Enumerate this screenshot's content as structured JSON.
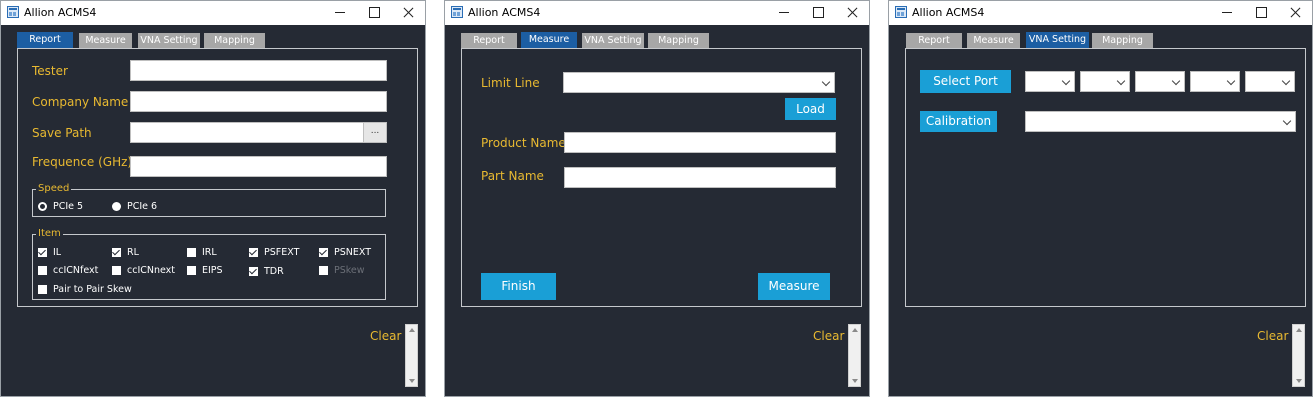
{
  "app": {
    "title": "Allion ACMS4"
  },
  "tabs": [
    "Report",
    "Measure",
    "VNA Setting",
    "Mapping"
  ],
  "report": {
    "fields": {
      "tester": "Tester",
      "company": "Company Name",
      "save_path": "Save Path",
      "frequence": "Frequence (GHz)"
    },
    "browse_label": "...",
    "speed": {
      "legend": "Speed",
      "options": [
        "PCIe 5",
        "PCIe 6"
      ],
      "selected": "PCIe 5"
    },
    "item": {
      "legend": "Item",
      "options": [
        {
          "label": "IL",
          "checked": true
        },
        {
          "label": "RL",
          "checked": true
        },
        {
          "label": "IRL",
          "checked": false
        },
        {
          "label": "PSFEXT",
          "checked": true
        },
        {
          "label": "PSNEXT",
          "checked": true
        },
        {
          "label": "ccICNfext",
          "checked": false
        },
        {
          "label": "ccICNnext",
          "checked": false
        },
        {
          "label": "EIPS",
          "checked": false
        },
        {
          "label": "TDR",
          "checked": true
        },
        {
          "label": "PSkew",
          "checked": false,
          "disabled": true
        },
        {
          "label": "Pair to Pair Skew",
          "checked": false
        }
      ]
    }
  },
  "measure": {
    "limit_line": "Limit Line",
    "load": "Load",
    "product_name": "Product Name",
    "part_name": "Part Name",
    "finish": "Finish",
    "measure": "Measure"
  },
  "vna": {
    "select_port": "Select Port",
    "calibration": "Calibration"
  },
  "footer": {
    "clear": "Clear"
  },
  "colors": {
    "background": "#252a34",
    "accent_label": "#e8b931",
    "button": "#1a9fd6",
    "active_tab": "#1c5ea3",
    "inactive_tab": "#a7a7a7"
  }
}
